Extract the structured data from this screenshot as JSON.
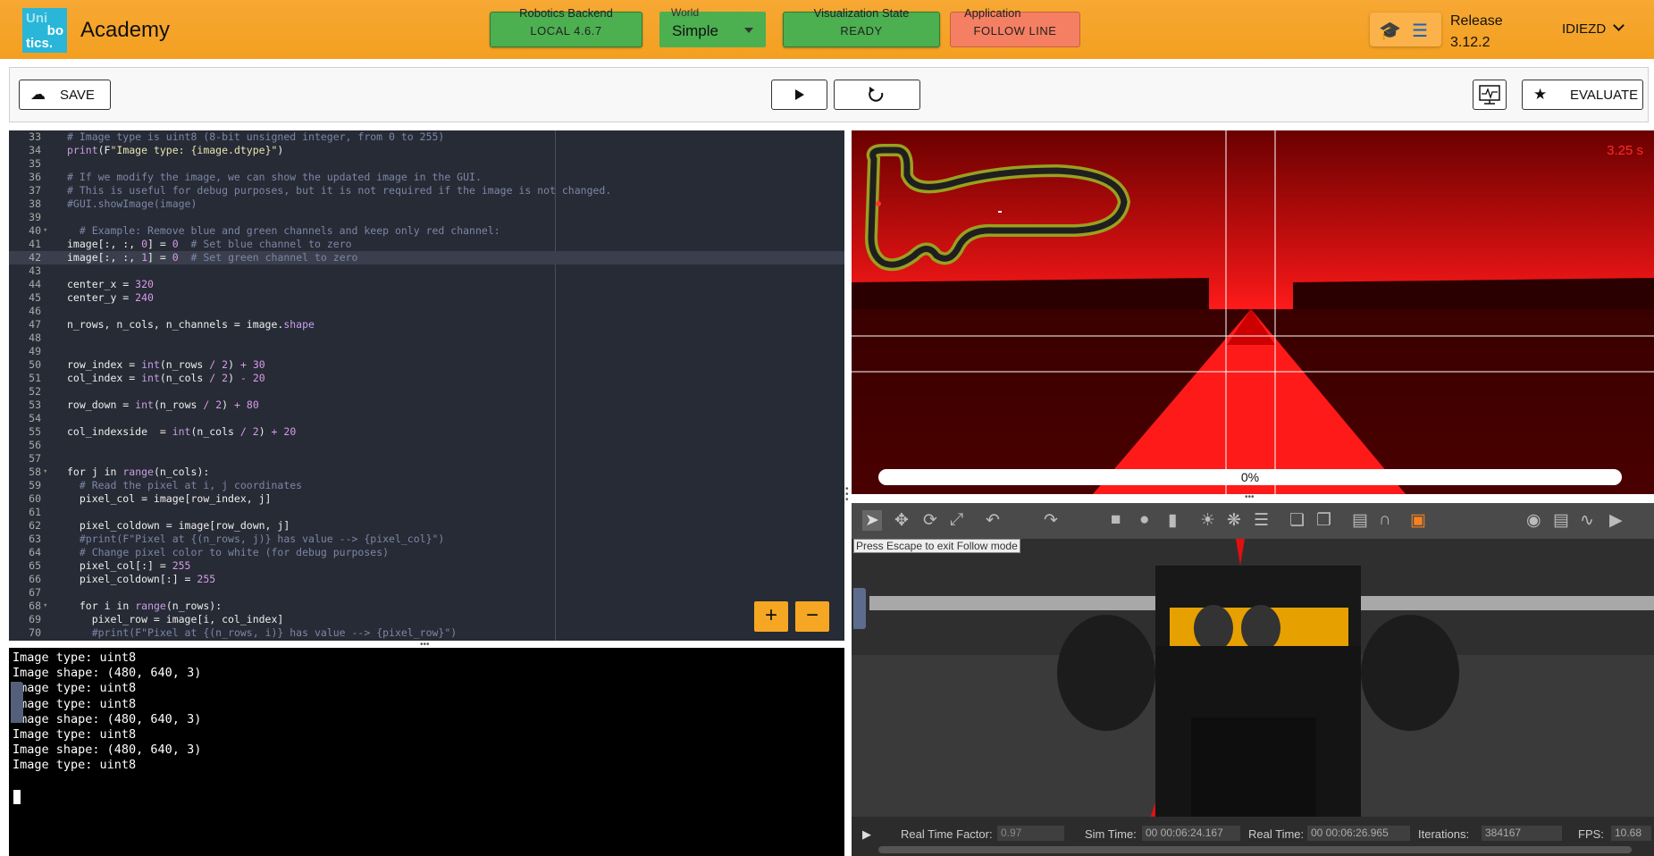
{
  "header": {
    "logo_lines": [
      "Uni",
      "bo",
      "tics."
    ],
    "app_title": "Academy",
    "backend": {
      "caption": "Robotics Backend",
      "value": "LOCAL 4.6.7"
    },
    "world": {
      "caption": "World",
      "value": "Simple"
    },
    "viz": {
      "caption": "Visualization State",
      "value": "READY"
    },
    "application": {
      "caption": "Application",
      "value": "FOLLOW LINE"
    },
    "icons": [
      "school-icon",
      "chat-icon"
    ],
    "release_label": "Release",
    "release_version": "3.12.2",
    "user": "IDIEZD"
  },
  "toolbar": {
    "save_label": "SAVE",
    "evaluate_label": "EVALUATE"
  },
  "editor": {
    "lines": [
      {
        "n": "33",
        "fold": false,
        "html": "<span class=\"cm\"># Image type is uint8 (8-bit unsigned integer, from 0 to 255)</span>"
      },
      {
        "n": "34",
        "fold": false,
        "html": "<span class=\"fn\">print</span>(F<span class=\"str\">\"Image type: {image.dtype}\"</span>)"
      },
      {
        "n": "35",
        "fold": false,
        "html": ""
      },
      {
        "n": "36",
        "fold": false,
        "html": "<span class=\"cm\"># If we modify the image, we can show the updated image in the GUI.</span>"
      },
      {
        "n": "37",
        "fold": false,
        "html": "<span class=\"cm\"># This is useful for debug purposes, but it is not required if the image is not changed.</span>"
      },
      {
        "n": "38",
        "fold": false,
        "html": "<span class=\"cm\">#GUI.showImage(image)</span>"
      },
      {
        "n": "39",
        "fold": false,
        "html": ""
      },
      {
        "n": "40",
        "fold": true,
        "html": "  <span class=\"cm\"># Example: Remove blue and green channels and keep only red channel:</span>"
      },
      {
        "n": "41",
        "fold": false,
        "html": "image[:, :, <span class=\"num\">0</span>] = <span class=\"num\">0</span>  <span class=\"cm\"># Set blue channel to zero</span>"
      },
      {
        "n": "42",
        "fold": false,
        "active": true,
        "html": "image[:, :, <span class=\"num\">1</span>] = <span class=\"num\">0</span>  <span class=\"cm\"># Set green channel to zero</span>"
      },
      {
        "n": "43",
        "fold": false,
        "html": ""
      },
      {
        "n": "44",
        "fold": false,
        "html": "center_x = <span class=\"num\">320</span>"
      },
      {
        "n": "45",
        "fold": false,
        "html": "center_y = <span class=\"num\">240</span>"
      },
      {
        "n": "46",
        "fold": false,
        "html": ""
      },
      {
        "n": "47",
        "fold": false,
        "html": "n_rows, n_cols, n_channels = image.<span class=\"at\">shape</span>"
      },
      {
        "n": "48",
        "fold": false,
        "html": ""
      },
      {
        "n": "49",
        "fold": false,
        "html": ""
      },
      {
        "n": "50",
        "fold": false,
        "html": "row_index = <span class=\"fn\">int</span>(n_rows <span class=\"num\">/</span> <span class=\"num\">2</span>) <span class=\"num\">+</span> <span class=\"num\">30</span>"
      },
      {
        "n": "51",
        "fold": false,
        "html": "col_index = <span class=\"fn\">int</span>(n_cols <span class=\"num\">/</span> <span class=\"num\">2</span>) <span class=\"num\">-</span> <span class=\"num\">20</span>"
      },
      {
        "n": "52",
        "fold": false,
        "html": ""
      },
      {
        "n": "53",
        "fold": false,
        "html": "row_down = <span class=\"fn\">int</span>(n_rows <span class=\"num\">/</span> <span class=\"num\">2</span>) <span class=\"num\">+</span> <span class=\"num\">80</span>"
      },
      {
        "n": "54",
        "fold": false,
        "html": ""
      },
      {
        "n": "55",
        "fold": false,
        "html": "col_indexside  = <span class=\"fn\">int</span>(n_cols <span class=\"num\">/</span> <span class=\"num\">2</span>) <span class=\"num\">+</span> <span class=\"num\">20</span>"
      },
      {
        "n": "56",
        "fold": false,
        "html": ""
      },
      {
        "n": "57",
        "fold": false,
        "html": ""
      },
      {
        "n": "58",
        "fold": true,
        "html": "<span class=\"kw\">for</span> j <span class=\"kw\">in</span> <span class=\"fn\">range</span>(n_cols):"
      },
      {
        "n": "59",
        "fold": false,
        "html": "  <span class=\"cm\"># Read the pixel at i, j coordinates</span>"
      },
      {
        "n": "60",
        "fold": false,
        "html": "  pixel_col = image[row_index, j]"
      },
      {
        "n": "61",
        "fold": false,
        "html": ""
      },
      {
        "n": "62",
        "fold": false,
        "html": "  pixel_coldown = image[row_down, j]"
      },
      {
        "n": "63",
        "fold": false,
        "html": "  <span class=\"cm\">#print(F\"Pixel at {(n_rows, j)} has value --> {pixel_col}\")</span>"
      },
      {
        "n": "64",
        "fold": false,
        "html": "  <span class=\"cm\"># Change pixel color to white (for debug purposes)</span>"
      },
      {
        "n": "65",
        "fold": false,
        "html": "  pixel_col[:] = <span class=\"num\">255</span>"
      },
      {
        "n": "66",
        "fold": false,
        "html": "  pixel_coldown[:] = <span class=\"num\">255</span>"
      },
      {
        "n": "67",
        "fold": false,
        "html": ""
      },
      {
        "n": "68",
        "fold": true,
        "html": "  <span class=\"kw\">for</span> i <span class=\"kw\">in</span> <span class=\"fn\">range</span>(n_rows):"
      },
      {
        "n": "69",
        "fold": false,
        "html": "    pixel_row = image[i, col_index]"
      },
      {
        "n": "70",
        "fold": false,
        "html": "    <span class=\"cm\">#print(F\"Pixel at {(n_rows, i)} has value --> {pixel_row}\")</span>"
      }
    ],
    "zoom_in": "+",
    "zoom_out": "−"
  },
  "console": {
    "lines": [
      "Image type: uint8",
      "Image shape: (480, 640, 3)",
      "Image type: uint8",
      "Image type: uint8",
      "Image shape: (480, 640, 3)",
      "Image type: uint8",
      "Image shape: (480, 640, 3)",
      "Image type: uint8"
    ]
  },
  "camera": {
    "timer": "3.25 s",
    "progress_text": "0%",
    "progress_fraction": 0.0
  },
  "gazebo": {
    "escape_hint": "Press Escape to exit Follow mode",
    "stats": {
      "rtf_label": "Real Time Factor:",
      "rtf_value": "0.97",
      "sim_label": "Sim Time:",
      "sim_value": "00 00:06:24.167",
      "real_label": "Real Time:",
      "real_value": "00 00:06:26.965",
      "iter_label": "Iterations:",
      "iter_value": "384167",
      "fps_label": "FPS:",
      "fps_value": "10.68"
    }
  },
  "colors": {
    "header": "#f5a623",
    "green_button": "#4caf50",
    "application_button": "#f57f62",
    "editor_bg": "#272b35",
    "timer": "#ff2a2a"
  }
}
